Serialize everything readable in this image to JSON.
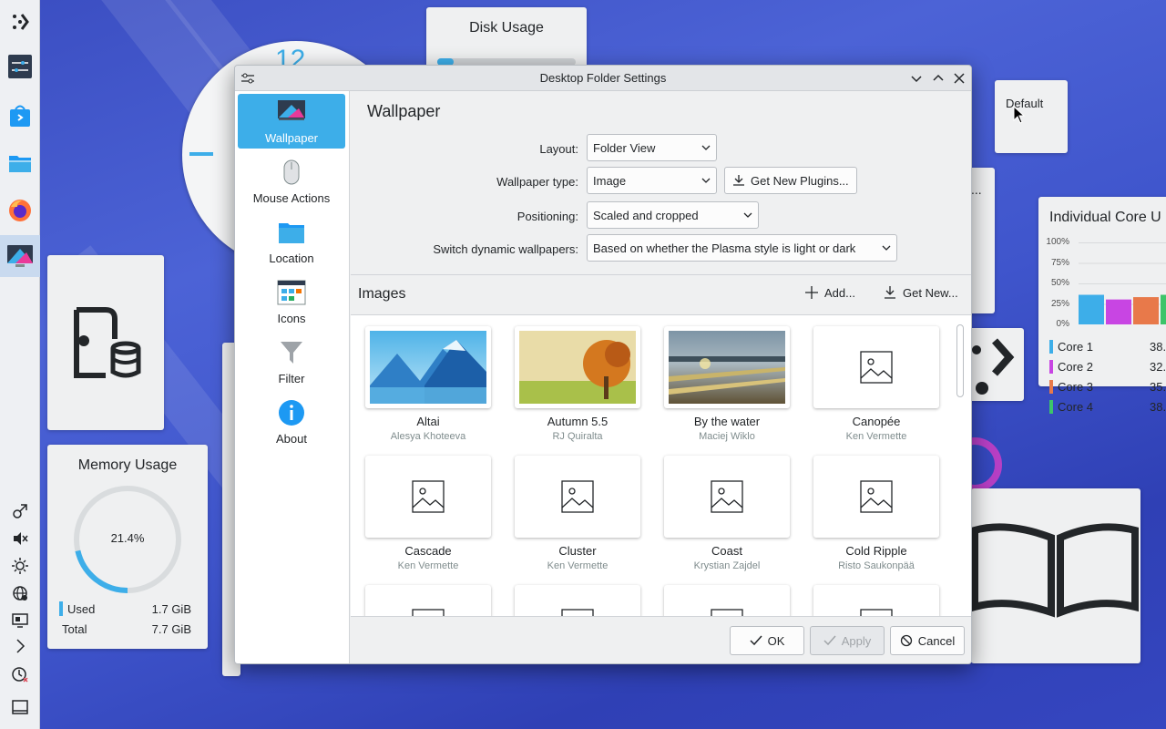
{
  "desktop": {
    "disk_usage_title": "Disk Usage",
    "default_label": "Default",
    "memory": {
      "title": "Memory Usage",
      "percent": "21.4%",
      "percent_value": 21.4,
      "used_label": "Used",
      "used_value": "1.7 GiB",
      "total_label": "Total",
      "total_value": "7.7 GiB"
    },
    "core_usage": {
      "title": "Individual Core U",
      "ticks": [
        "100%",
        "75%",
        "50%",
        "25%",
        "0%"
      ],
      "cores": [
        {
          "name": "Core 1",
          "value": "38.",
          "color": "#3daee9",
          "level": 0.38
        },
        {
          "name": "Core 2",
          "value": "32.",
          "color": "#c845e3",
          "level": 0.32
        },
        {
          "name": "Core 3",
          "value": "35.",
          "color": "#e8794a",
          "level": 0.35
        },
        {
          "name": "Core 4",
          "value": "38.",
          "color": "#3dc46a",
          "level": 0.38
        }
      ]
    },
    "clock_number": "12",
    "partial_label": "..."
  },
  "dialog": {
    "title": "Desktop Folder Settings",
    "sidebar": [
      {
        "label": "Wallpaper",
        "icon": "monitor-icon"
      },
      {
        "label": "Mouse Actions",
        "icon": "mouse-icon"
      },
      {
        "label": "Location",
        "icon": "folder-icon"
      },
      {
        "label": "Icons",
        "icon": "icons-icon"
      },
      {
        "label": "Filter",
        "icon": "filter-icon"
      },
      {
        "label": "About",
        "icon": "info-icon"
      }
    ],
    "page_title": "Wallpaper",
    "form": {
      "layout_label": "Layout:",
      "layout_value": "Folder View",
      "type_label": "Wallpaper type:",
      "type_value": "Image",
      "get_plugins": "Get New Plugins...",
      "positioning_label": "Positioning:",
      "positioning_value": "Scaled and cropped",
      "dynamic_label": "Switch dynamic wallpapers:",
      "dynamic_value": "Based on whether the Plasma style is light or dark"
    },
    "images": {
      "title": "Images",
      "add": "Add...",
      "get_new": "Get New...",
      "items": [
        {
          "name": "Altai",
          "author": "Alesya Khoteeva"
        },
        {
          "name": "Autumn 5.5",
          "author": "RJ Quiralta"
        },
        {
          "name": "By the water",
          "author": "Maciej Wiklo"
        },
        {
          "name": "Canopée",
          "author": "Ken Vermette"
        },
        {
          "name": "Cascade",
          "author": "Ken Vermette"
        },
        {
          "name": "Cluster",
          "author": "Ken Vermette"
        },
        {
          "name": "Coast",
          "author": "Krystian Zajdel"
        },
        {
          "name": "Cold Ripple",
          "author": "Risto Saukonpää"
        }
      ]
    },
    "buttons": {
      "ok": "OK",
      "apply": "Apply",
      "cancel": "Cancel"
    }
  }
}
